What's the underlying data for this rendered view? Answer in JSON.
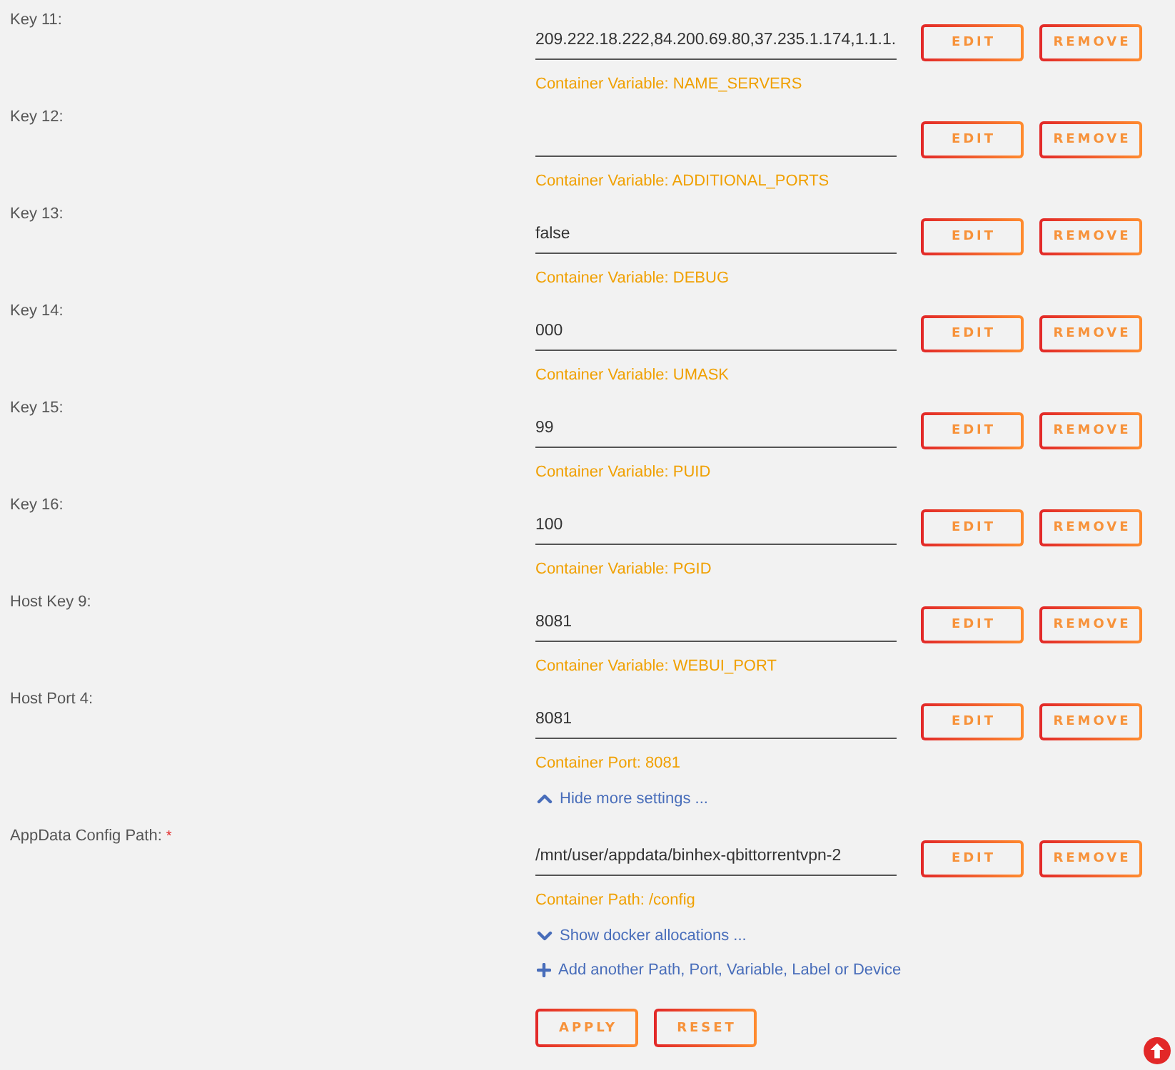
{
  "settings": [
    {
      "kind": "field",
      "label": "Key 11:",
      "value": "209.222.18.222,84.200.69.80,37.235.1.174,1.1.1.",
      "buttons": [
        "EDIT",
        "REMOVE"
      ],
      "hint": "Container Variable: NAME_SERVERS"
    },
    {
      "kind": "field",
      "label": "Key 12:",
      "buttons": [
        "EDIT",
        "REMOVE"
      ],
      "hint": "Container Variable: ADDITIONAL_PORTS"
    },
    {
      "kind": "field",
      "label": "Key 13:",
      "value": "false",
      "buttons": [
        "EDIT",
        "REMOVE"
      ],
      "hint": "Container Variable: DEBUG"
    },
    {
      "kind": "field",
      "label": "Key 14:",
      "value": "000",
      "buttons": [
        "EDIT",
        "REMOVE"
      ],
      "hint": "Container Variable: UMASK"
    },
    {
      "kind": "field",
      "label": "Key 15:",
      "value": "99",
      "buttons": [
        "EDIT",
        "REMOVE"
      ],
      "hint": "Container Variable: PUID"
    },
    {
      "kind": "field",
      "label": "Key 16:",
      "value": "100",
      "buttons": [
        "EDIT",
        "REMOVE"
      ],
      "hint": "Container Variable: PGID"
    },
    {
      "kind": "field",
      "label": "Host Key 9:",
      "value": "8081",
      "buttons": [
        "EDIT",
        "REMOVE"
      ],
      "hint": "Container Variable: WEBUI_PORT"
    },
    {
      "kind": "field",
      "label": "Host Port 4:",
      "value": "8081",
      "buttons": [
        "EDIT",
        "REMOVE"
      ],
      "hint": "Container Port: 8081"
    },
    {
      "kind": "toggle",
      "label": "Hide more settings ...",
      "expanded": true
    },
    {
      "kind": "field",
      "label": "AppData Config Path:",
      "required_mark": "*",
      "value": "/mnt/user/appdata/binhex-qbittorrentvpn-2",
      "buttons": [
        "EDIT",
        "REMOVE"
      ],
      "hint": "Container Path: /config"
    },
    {
      "kind": "toggle",
      "label": "Show docker allocations ...",
      "expanded": false
    },
    {
      "kind": "add",
      "label": "Add another Path, Port, Variable, Label or Device"
    }
  ],
  "actions": [
    "APPLY",
    "RESET"
  ]
}
